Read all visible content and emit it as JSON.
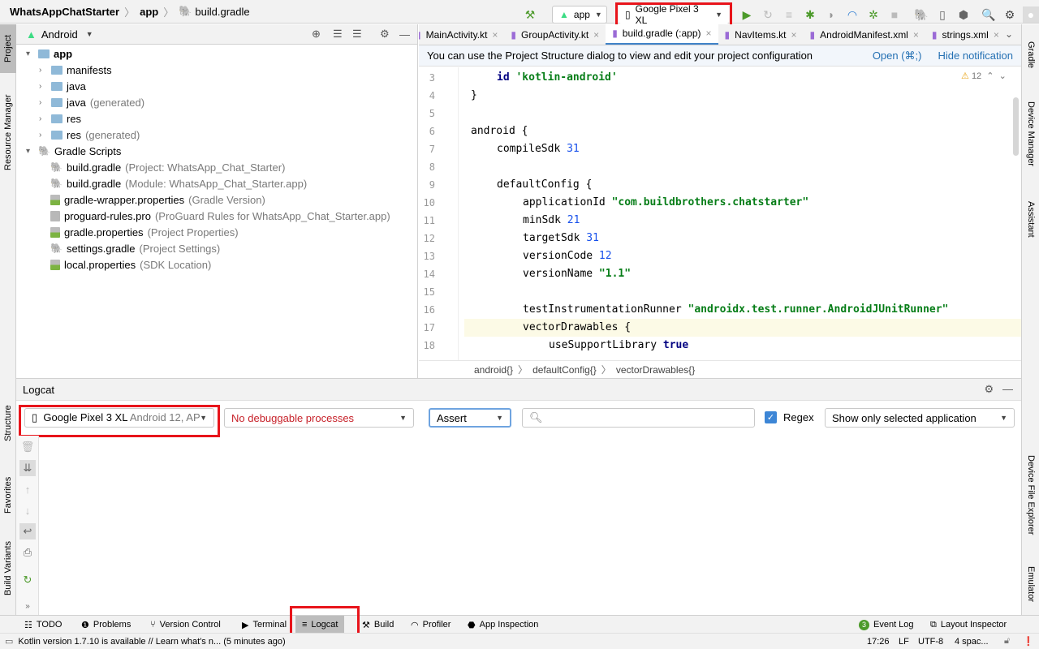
{
  "breadcrumb": [
    "WhatsAppChatStarter",
    "app",
    "build.gradle"
  ],
  "toolbar": {
    "config": "app",
    "device": "Google Pixel 3 XL"
  },
  "left_strip": [
    "Project",
    "Resource Manager",
    "Structure",
    "Favorites",
    "Build Variants"
  ],
  "right_strip": [
    "Gradle",
    "Device Manager",
    "Assistant",
    "Device File Explorer",
    "Emulator"
  ],
  "project": {
    "view": "Android",
    "tree": [
      {
        "label": "app",
        "extra": "",
        "depth": 0,
        "icon": "folder-icon",
        "bold": true
      },
      {
        "label": "manifests",
        "extra": "",
        "depth": 1,
        "icon": "folder-icon"
      },
      {
        "label": "java",
        "extra": "",
        "depth": 1,
        "icon": "folder-icon"
      },
      {
        "label": "java",
        "extra": "(generated)",
        "depth": 1,
        "icon": "folder-icon"
      },
      {
        "label": "res",
        "extra": "",
        "depth": 1,
        "icon": "folder-icon"
      },
      {
        "label": "res",
        "extra": "(generated)",
        "depth": 1,
        "icon": "folder-icon"
      },
      {
        "label": "Gradle Scripts",
        "extra": "",
        "depth": 0,
        "icon": "gradle-icon"
      },
      {
        "label": "build.gradle",
        "extra": "(Project: WhatsApp_Chat_Starter)",
        "depth": 2,
        "icon": "gradle-icon"
      },
      {
        "label": "build.gradle",
        "extra": "(Module: WhatsApp_Chat_Starter.app)",
        "depth": 2,
        "icon": "gradle-icon"
      },
      {
        "label": "gradle-wrapper.properties",
        "extra": "(Gradle Version)",
        "depth": 2,
        "icon": "properties-icon"
      },
      {
        "label": "proguard-rules.pro",
        "extra": "(ProGuard Rules for WhatsApp_Chat_Starter.app)",
        "depth": 2,
        "icon": "file-icon"
      },
      {
        "label": "gradle.properties",
        "extra": "(Project Properties)",
        "depth": 2,
        "icon": "properties-icon"
      },
      {
        "label": "settings.gradle",
        "extra": "(Project Settings)",
        "depth": 2,
        "icon": "gradle-icon"
      },
      {
        "label": "local.properties",
        "extra": "(SDK Location)",
        "depth": 2,
        "icon": "properties-icon"
      }
    ]
  },
  "editor": {
    "tabs": [
      "MainActivity.kt",
      "GroupActivity.kt",
      "build.gradle (:app)",
      "NavItems.kt",
      "AndroidManifest.xml",
      "strings.xml"
    ],
    "active_tab": 2,
    "notification": "You can use the Project Structure dialog to view and edit your project configuration",
    "notif_open": "Open (⌘;)",
    "notif_hide": "Hide notification",
    "warnings": "12",
    "lines": [
      {
        "n": "3",
        "indent": 1,
        "parts": [
          [
            "kw",
            "id "
          ],
          [
            "str",
            "'kotlin-android'"
          ]
        ]
      },
      {
        "n": "4",
        "indent": 0,
        "parts": [
          [
            "",
            "}"
          ]
        ]
      },
      {
        "n": "5",
        "indent": 0,
        "parts": []
      },
      {
        "n": "6",
        "indent": 0,
        "parts": [
          [
            "",
            "android {"
          ]
        ]
      },
      {
        "n": "7",
        "indent": 1,
        "parts": [
          [
            "",
            "compileSdk "
          ],
          [
            "num",
            "31"
          ]
        ]
      },
      {
        "n": "8",
        "indent": 0,
        "parts": []
      },
      {
        "n": "9",
        "indent": 1,
        "parts": [
          [
            "",
            "defaultConfig {"
          ]
        ]
      },
      {
        "n": "10",
        "indent": 2,
        "parts": [
          [
            "",
            "applicationId "
          ],
          [
            "str",
            "\"com.buildbrothers.chatstarter\""
          ]
        ]
      },
      {
        "n": "11",
        "indent": 2,
        "parts": [
          [
            "",
            "minSdk "
          ],
          [
            "num",
            "21"
          ]
        ]
      },
      {
        "n": "12",
        "indent": 2,
        "parts": [
          [
            "",
            "targetSdk "
          ],
          [
            "num",
            "31"
          ]
        ]
      },
      {
        "n": "13",
        "indent": 2,
        "parts": [
          [
            "",
            "versionCode "
          ],
          [
            "num",
            "12"
          ]
        ]
      },
      {
        "n": "14",
        "indent": 2,
        "parts": [
          [
            "",
            "versionName "
          ],
          [
            "str",
            "\"1.1\""
          ]
        ]
      },
      {
        "n": "15",
        "indent": 0,
        "parts": []
      },
      {
        "n": "16",
        "indent": 2,
        "parts": [
          [
            "",
            "testInstrumentationRunner "
          ],
          [
            "str",
            "\"androidx.test.runner.AndroidJUnitRunner\""
          ]
        ]
      },
      {
        "n": "17",
        "indent": 2,
        "parts": [
          [
            "",
            "vectorDrawables {"
          ]
        ]
      },
      {
        "n": "18",
        "indent": 3,
        "parts": [
          [
            "",
            "useSupportLibrary "
          ],
          [
            "kw",
            "true"
          ]
        ]
      }
    ],
    "highlight_line": "17",
    "breadcrumb": [
      "android{}",
      "defaultConfig{}",
      "vectorDrawables{}"
    ]
  },
  "logcat": {
    "title": "Logcat",
    "device": "Google Pixel 3 XL",
    "device_extra": "Android 12, AP",
    "process": "No debuggable processes",
    "level": "Assert",
    "search_placeholder": "",
    "regex_label": "Regex",
    "regex_checked": true,
    "filter": "Show only selected application"
  },
  "tool_windows": {
    "left": [
      "TODO",
      "Problems",
      "Version Control",
      "Terminal",
      "Logcat",
      "Build",
      "Profiler",
      "App Inspection"
    ],
    "right": [
      "Event Log",
      "Layout Inspector"
    ],
    "event_count": "3"
  },
  "status": {
    "message": "Kotlin version 1.7.10 is available // Learn what's n... (5 minutes ago)",
    "position": "17:26",
    "line_sep": "LF",
    "encoding": "UTF-8",
    "indent": "4 spac..."
  }
}
